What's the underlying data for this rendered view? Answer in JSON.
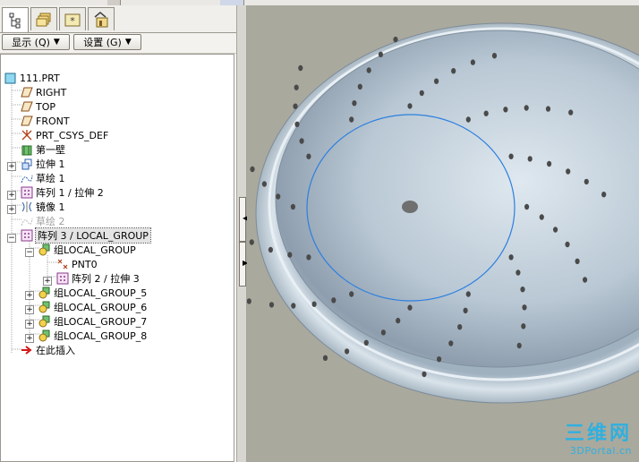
{
  "tabs": [
    {
      "icon": "model-tree-icon",
      "active": true
    },
    {
      "icon": "folder-browser-icon",
      "active": false
    },
    {
      "icon": "favorites-icon",
      "active": false
    },
    {
      "icon": "connections-icon",
      "active": false
    }
  ],
  "toolbar": {
    "show_label": "显示 (Q)",
    "settings_label": "设置 (G)"
  },
  "tree": {
    "root": "111.PRT",
    "items": [
      {
        "label": "RIGHT"
      },
      {
        "label": "TOP"
      },
      {
        "label": "FRONT"
      },
      {
        "label": "PRT_CSYS_DEF"
      },
      {
        "label": "第一壁"
      },
      {
        "label": "拉伸 1"
      },
      {
        "label": "草绘 1"
      },
      {
        "label": "阵列 1 / 拉伸 2"
      },
      {
        "label": "镜像 1"
      },
      {
        "label": "草绘 2"
      },
      {
        "label": "阵列 3 / LOCAL_GROUP"
      },
      {
        "label": "组LOCAL_GROUP"
      },
      {
        "label": "PNT0"
      },
      {
        "label": "阵列 2 / 拉伸 3"
      },
      {
        "label": "组LOCAL_GROUP_5"
      },
      {
        "label": "组LOCAL_GROUP_6"
      },
      {
        "label": "组LOCAL_GROUP_7"
      },
      {
        "label": "组LOCAL_GROUP_8"
      },
      {
        "label": "在此插入"
      }
    ]
  },
  "viewport": {
    "background": "#aaa99d",
    "model_color": "#b9c8d4",
    "sketch_circle_color": "#2d7fe0"
  },
  "watermark": {
    "title": "三维网",
    "url": "3DPortal.cn"
  }
}
